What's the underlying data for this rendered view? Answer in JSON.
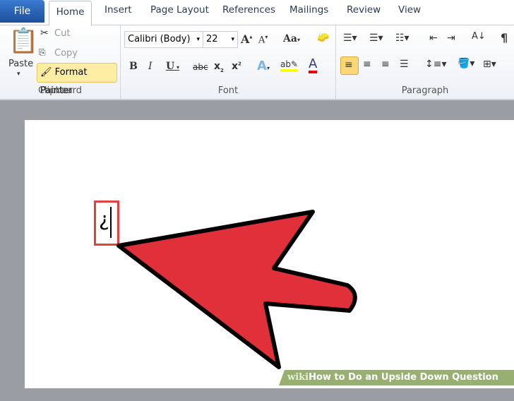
{
  "tabs": {
    "file": "File",
    "home": "Home",
    "insert": "Insert",
    "page_layout": "Page Layout",
    "references": "References",
    "mailings": "Mailings",
    "review": "Review",
    "view": "View"
  },
  "clipboard": {
    "paste": "Paste",
    "cut": "Cut",
    "copy": "Copy",
    "format_painter": "Format Painter",
    "label": "Clipboard"
  },
  "font": {
    "name": "Calibri (Body)",
    "size": "22",
    "label": "Font"
  },
  "paragraph": {
    "label": "Paragraph"
  },
  "document": {
    "text": "¿"
  },
  "watermark": {
    "brand": "wiki",
    "title": "How to Do an Upside Down Question Mark"
  },
  "colors": {
    "arrow": "#e0313b",
    "highlight": "#fbd776",
    "file_tab": "#2a63b8"
  }
}
